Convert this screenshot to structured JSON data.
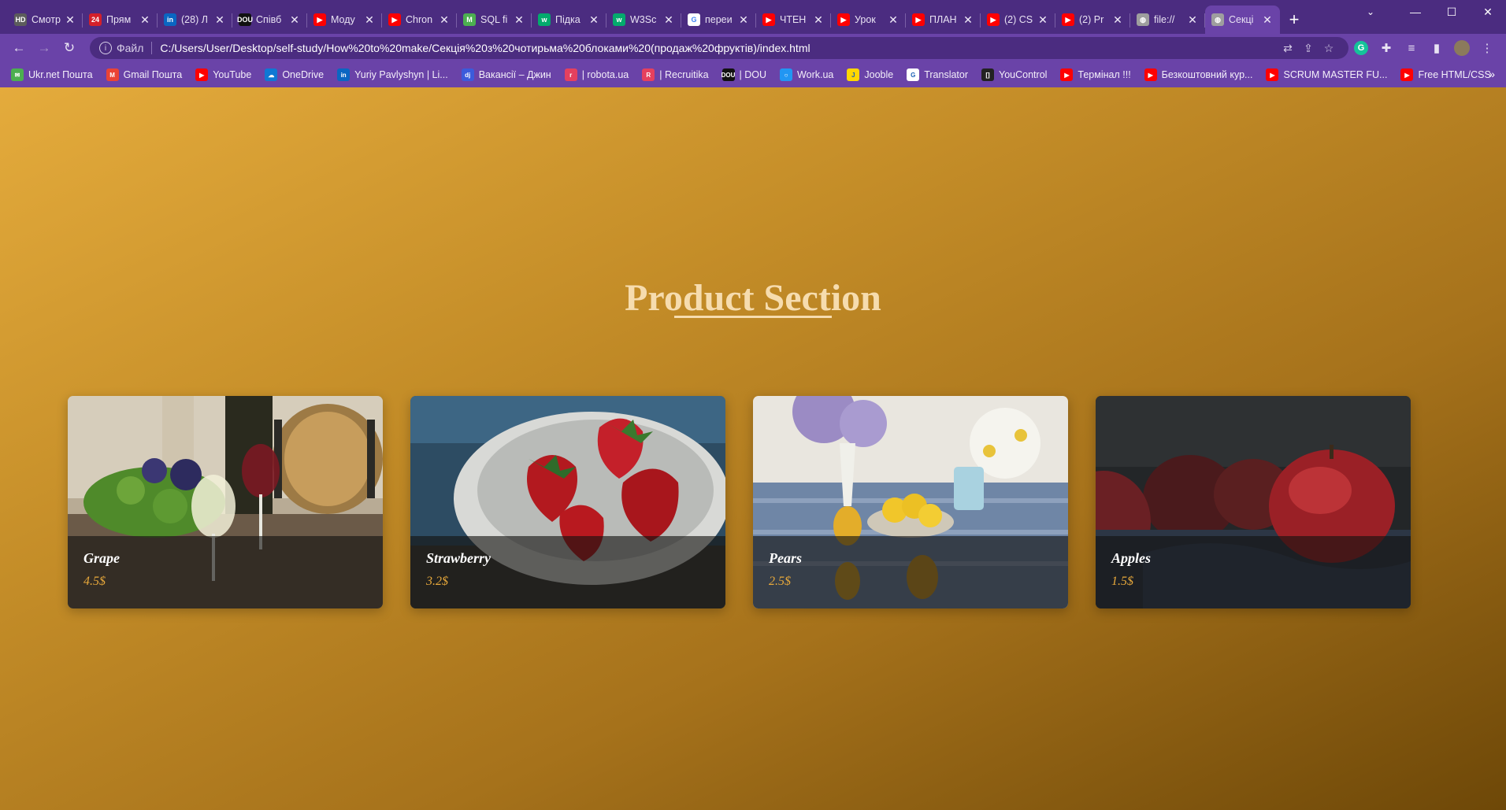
{
  "browser": {
    "tabs": [
      {
        "title": "Смотр",
        "icon": "hd-icon",
        "color": "#5c5c5c",
        "glyph": "HD"
      },
      {
        "title": "Прям",
        "icon": "news24-icon",
        "color": "#d4202a",
        "glyph": "24"
      },
      {
        "title": "(28) Л",
        "icon": "linkedin-icon",
        "color": "#0a66c2",
        "glyph": "in"
      },
      {
        "title": "Співб",
        "icon": "dou-icon",
        "color": "#111111",
        "glyph": "DOU"
      },
      {
        "title": "Моду",
        "icon": "youtube-icon",
        "color": "#ff0000",
        "glyph": "▶"
      },
      {
        "title": "Chron",
        "icon": "youtube-icon",
        "color": "#ff0000",
        "glyph": "▶"
      },
      {
        "title": "SQL fi",
        "icon": "m-icon",
        "color": "#4caf50",
        "glyph": "M"
      },
      {
        "title": "Підка",
        "icon": "w3schools-icon",
        "color": "#04aa6d",
        "glyph": "w"
      },
      {
        "title": "W3Sc",
        "icon": "w3schools-icon",
        "color": "#04aa6d",
        "glyph": "w"
      },
      {
        "title": "переи",
        "icon": "google-icon",
        "color": "#ffffff",
        "glyph": "G"
      },
      {
        "title": "ЧТЕН",
        "icon": "youtube-icon",
        "color": "#ff0000",
        "glyph": "▶"
      },
      {
        "title": "Урок",
        "icon": "youtube-icon",
        "color": "#ff0000",
        "glyph": "▶"
      },
      {
        "title": "ПЛАН",
        "icon": "youtube-icon",
        "color": "#ff0000",
        "glyph": "▶"
      },
      {
        "title": "(2) CS",
        "icon": "youtube-icon",
        "color": "#ff0000",
        "glyph": "▶"
      },
      {
        "title": "(2) Pr",
        "icon": "youtube-icon",
        "color": "#ff0000",
        "glyph": "▶"
      },
      {
        "title": "file://",
        "icon": "globe-icon",
        "color": "#9e9e9e",
        "glyph": "◍"
      },
      {
        "title": "Секці",
        "icon": "globe-icon",
        "color": "#9e9e9e",
        "glyph": "◍",
        "active": true
      }
    ],
    "new_tab": "+",
    "url_scheme": "Файл",
    "url": "C:/Users/User/Desktop/self-study/How%20to%20make/Секція%20з%20чотирьма%20блоками%20(продаж%20фруктів)/index.html",
    "bookmarks": [
      {
        "label": "Ukr.net Пошта",
        "icon": "ukrnet-icon",
        "color": "#4caf50",
        "glyph": "✉"
      },
      {
        "label": "Gmail Пошта",
        "icon": "gmail-icon",
        "color": "#ea4335",
        "glyph": "M"
      },
      {
        "label": "YouTube",
        "icon": "youtube-icon",
        "color": "#ff0000",
        "glyph": "▶"
      },
      {
        "label": "OneDrive",
        "icon": "onedrive-icon",
        "color": "#0f78d4",
        "glyph": "☁"
      },
      {
        "label": "Yuriy Pavlyshyn | Li...",
        "icon": "linkedin-icon",
        "color": "#0a66c2",
        "glyph": "in"
      },
      {
        "label": "Вакансії – Джин",
        "icon": "djinni-icon",
        "color": "#3b5bdb",
        "glyph": "dj"
      },
      {
        "label": "| robota.ua",
        "icon": "robota-icon",
        "color": "#e5405e",
        "glyph": "r"
      },
      {
        "label": "| Recruitika",
        "icon": "recruitika-icon",
        "color": "#e5405e",
        "glyph": "R"
      },
      {
        "label": "| DOU",
        "icon": "dou-icon",
        "color": "#111111",
        "glyph": "DOU"
      },
      {
        "label": "Work.ua",
        "icon": "workua-icon",
        "color": "#2196f3",
        "glyph": "○"
      },
      {
        "label": "Jooble",
        "icon": "jooble-icon",
        "color": "#ffd600",
        "glyph": "J"
      },
      {
        "label": "Translator",
        "icon": "google-icon",
        "color": "#ffffff",
        "glyph": "G"
      },
      {
        "label": "YouControl",
        "icon": "youcontrol-icon",
        "color": "#222222",
        "glyph": "[]"
      },
      {
        "label": "Термінал !!!",
        "icon": "youtube-icon",
        "color": "#ff0000",
        "glyph": "▶"
      },
      {
        "label": "Безкоштовний кур...",
        "icon": "youtube-icon",
        "color": "#ff0000",
        "glyph": "▶"
      },
      {
        "label": "SCRUM MASTER FU...",
        "icon": "youtube-icon",
        "color": "#ff0000",
        "glyph": "▶"
      },
      {
        "label": "Free HTML/CSS",
        "icon": "youtube-icon",
        "color": "#ff0000",
        "glyph": "▶"
      }
    ],
    "bookmarks_more": "»"
  },
  "page": {
    "title": "Product Section",
    "products": [
      {
        "name": "Grape",
        "price": "4.5$",
        "image": "grapes-and-wine-photo"
      },
      {
        "name": "Strawberry",
        "price": "3.2$",
        "image": "strawberries-bowl-photo"
      },
      {
        "name": "Pears",
        "price": "2.5$",
        "image": "pears-and-flowers-photo"
      },
      {
        "name": "Apples",
        "price": "1.5$",
        "image": "red-apples-photo"
      }
    ]
  },
  "colors": {
    "browser_frame": "#4b2c80",
    "toolbar": "#6a43a8",
    "page_gradient_start": "#e4ab3c",
    "page_gradient_end": "#6e4808",
    "title_color": "#f6dcae",
    "price_color": "#e8a93b"
  }
}
